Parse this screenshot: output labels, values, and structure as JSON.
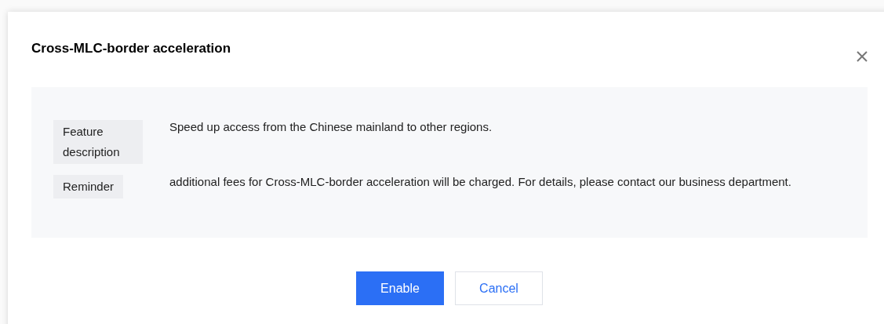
{
  "dialog": {
    "title": "Cross-MLC-border acceleration",
    "details": [
      {
        "label": "Feature description",
        "text": "Speed up access from the Chinese mainland to other regions."
      },
      {
        "label": "Reminder",
        "text": "additional fees for Cross-MLC-border acceleration will be charged. For details, please contact our business department."
      }
    ],
    "buttons": [
      {
        "label": "Enable",
        "kind": "primary"
      },
      {
        "label": "Cancel",
        "kind": "default"
      }
    ]
  }
}
